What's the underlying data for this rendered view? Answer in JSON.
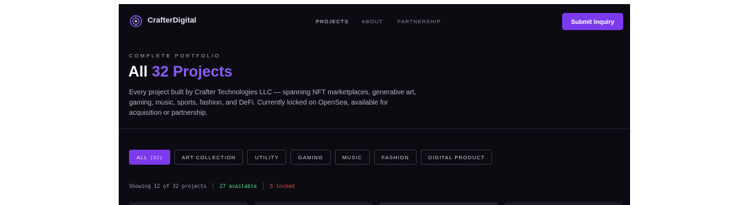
{
  "header": {
    "brand": "CrafterDigital",
    "nav": [
      {
        "label": "PROJECTS",
        "active": true
      },
      {
        "label": "ABOUT",
        "active": false
      },
      {
        "label": "PARTNERSHIP",
        "active": false
      }
    ],
    "cta_label": "Submit Inquiry"
  },
  "hero": {
    "eyebrow": "COMPLETE PORTFOLIO",
    "title_prefix": "All",
    "title_accent": "32 Projects",
    "description": "Every project built by Crafter Technologies LLC — spanning NFT marketplaces, generative art, gaming, music, sports, fashion, and DeFi. Currently locked on OpenSea, available for acquisition or partnership."
  },
  "filters": [
    {
      "label": "ALL",
      "count": "(32)",
      "active": true
    },
    {
      "label": "ART COLLECTION",
      "count": "",
      "active": false
    },
    {
      "label": "UTILITY",
      "count": "",
      "active": false
    },
    {
      "label": "GAMING",
      "count": "",
      "active": false
    },
    {
      "label": "MUSIC",
      "count": "",
      "active": false
    },
    {
      "label": "FASHION",
      "count": "",
      "active": false
    },
    {
      "label": "DIGITAL PRODUCT",
      "count": "",
      "active": false
    }
  ],
  "status": {
    "showing": "Showing 12 of 32 projects",
    "available": "27 available",
    "locked": "5 locked"
  },
  "colors": {
    "background": "#0c0b12",
    "accent": "#7c3aed",
    "accent_text": "#8b5cf6",
    "available": "#4ade80",
    "locked": "#ef4444"
  }
}
